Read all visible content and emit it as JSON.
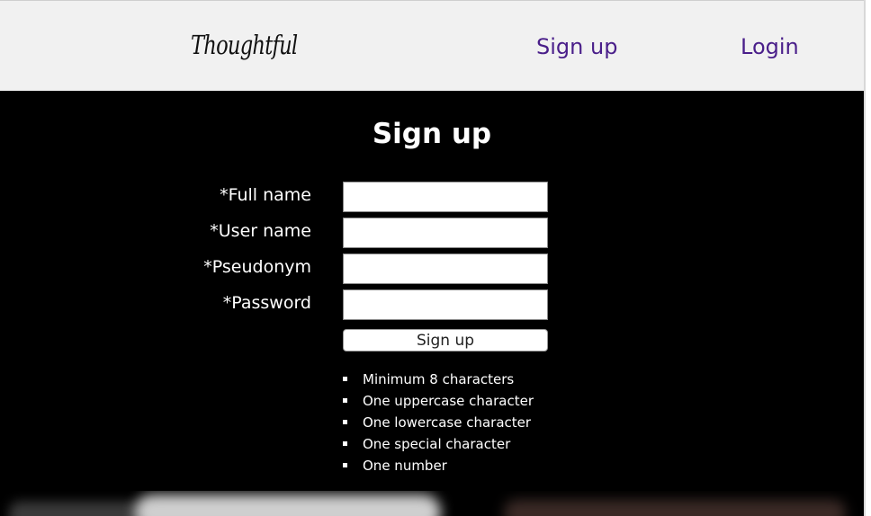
{
  "header": {
    "logo_text": "Thoughtful",
    "nav": {
      "signup_label": "Sign up",
      "login_label": "Login"
    }
  },
  "form": {
    "title": "Sign up",
    "fields": {
      "full_name_label": "*Full name",
      "user_name_label": "*User name",
      "pseudonym_label": "*Pseudonym",
      "password_label": "*Password"
    },
    "submit_label": "Sign up",
    "requirements": [
      "Minimum 8 characters",
      "One uppercase character",
      "One lowercase character",
      "One special character",
      "One number"
    ]
  },
  "colors": {
    "header_bg": "#f1f1f1",
    "page_bg": "#000000",
    "nav_link": "#4a1f8a",
    "text_light": "#ffffff"
  }
}
